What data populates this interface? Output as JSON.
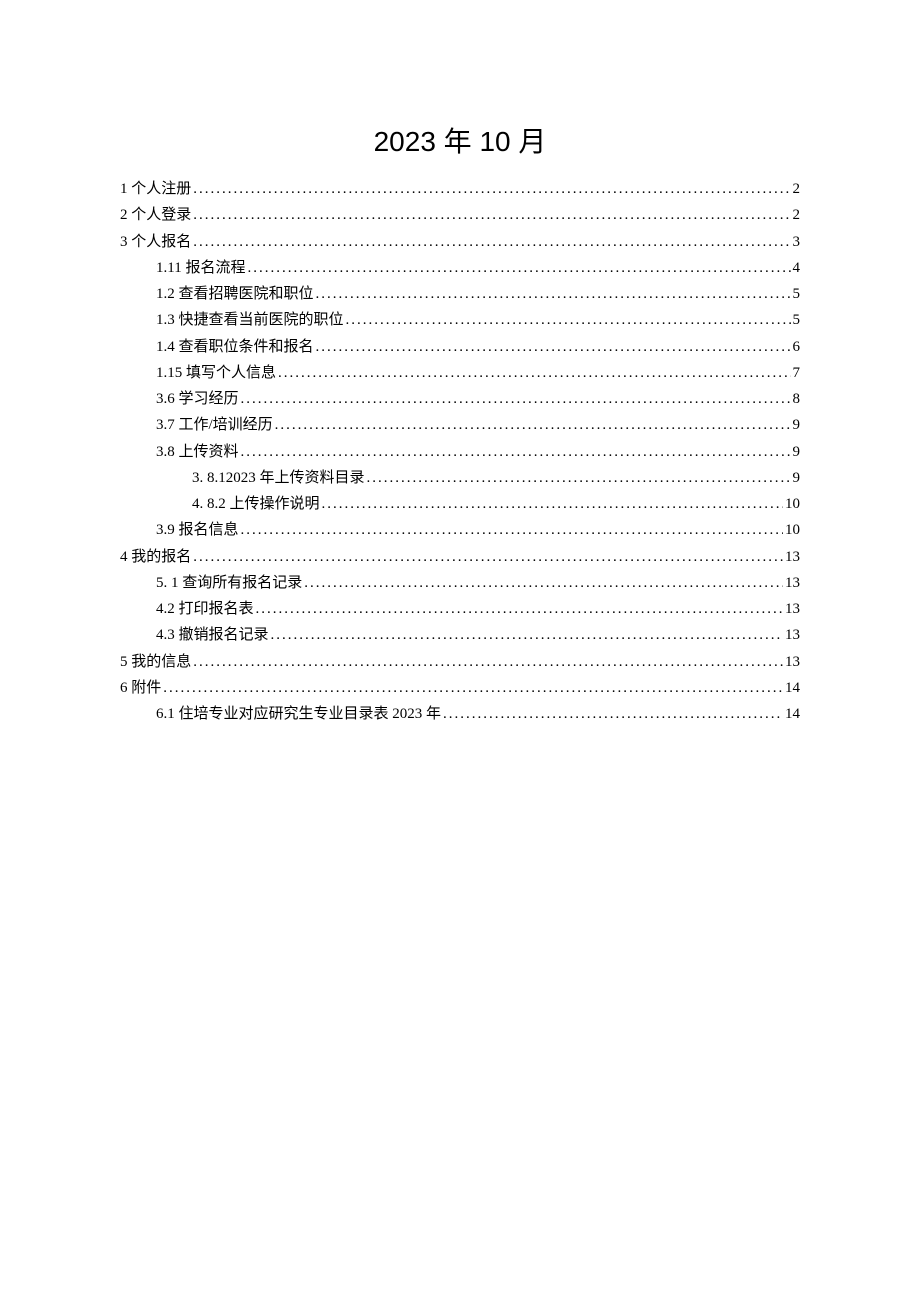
{
  "title": "2023 年 10 月",
  "toc": [
    {
      "label": "1 个人注册",
      "page": "2",
      "indent": 0,
      "trailing_space": true
    },
    {
      "label": "2 个人登录",
      "page": "2",
      "indent": 0,
      "trailing_space": true
    },
    {
      "label": "3 个人报名",
      "page": "3",
      "indent": 0,
      "trailing_space": true
    },
    {
      "label": "1.11 报名流程",
      "page": "4",
      "indent": 1,
      "trailing_space": true
    },
    {
      "label": "1.2  查看招聘医院和职位",
      "page": "5",
      "indent": 1,
      "trailing_space": false
    },
    {
      "label": "1.3  快捷查看当前医院的职位",
      "page": "5",
      "indent": 1,
      "trailing_space": false
    },
    {
      "label": "1.4  查看职位条件和报名",
      "page": "6",
      "indent": 1,
      "trailing_space": false
    },
    {
      "label": "1.15 填写个人信息",
      "page": "7",
      "indent": 1,
      "trailing_space": true
    },
    {
      "label": "3.6  学习经历",
      "page": "8",
      "indent": 1,
      "trailing_space": false
    },
    {
      "label": "3.7  工作/培训经历",
      "page": "9",
      "indent": 1,
      "trailing_space": false
    },
    {
      "label": "3.8  上传资料",
      "page": "9",
      "indent": 1,
      "trailing_space": false
    },
    {
      "label": "3. 8.12023 年上传资料目录",
      "page": "9",
      "indent": 2,
      "trailing_space": false
    },
    {
      "label": "4. 8.2 上传操作说明",
      "page": "10",
      "indent": 2,
      "trailing_space": false
    },
    {
      "label": "3.9 报名信息",
      "page": "10",
      "indent": 1,
      "trailing_space": false
    },
    {
      "label": "4 我的报名",
      "page": "13",
      "indent": 0,
      "trailing_space": true
    },
    {
      "label": "5. 1 查询所有报名记录",
      "page": "13",
      "indent": 1,
      "trailing_space": true
    },
    {
      "label": "4.2 打印报名表",
      "page": "13",
      "indent": 1,
      "trailing_space": false
    },
    {
      "label": "4.3 撤销报名记录",
      "page": "13",
      "indent": 1,
      "trailing_space": false
    },
    {
      "label": "5 我的信息",
      "page": "13",
      "indent": 0,
      "trailing_space": true
    },
    {
      "label": "6 附件",
      "page": "14",
      "indent": 0,
      "trailing_space": true
    },
    {
      "label": "6.1 住培专业对应研究生专业目录表 2023 年",
      "page": "14",
      "indent": 1,
      "trailing_space": false
    }
  ]
}
